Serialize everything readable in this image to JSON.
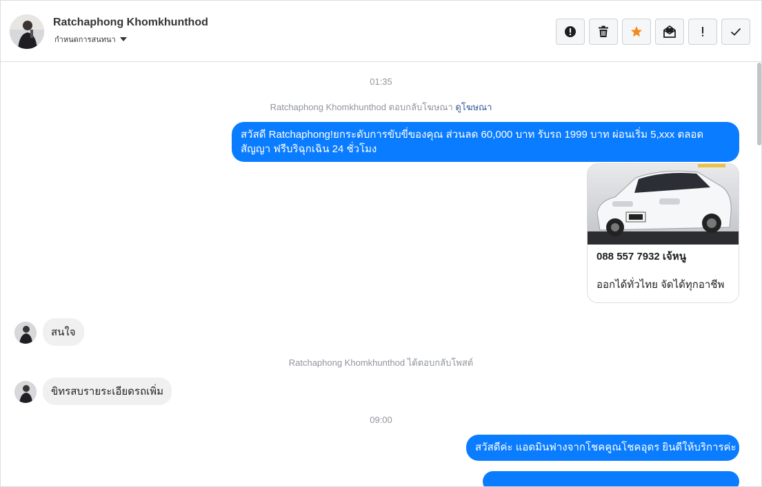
{
  "header": {
    "contact_name": "Ratchaphong Khomkhunthod",
    "assign_label": "กำหนดการสนทนา",
    "actions": [
      {
        "name": "spam-button",
        "icon": "alert-circle-icon"
      },
      {
        "name": "delete-button",
        "icon": "trash-icon"
      },
      {
        "name": "star-button",
        "icon": "star-icon"
      },
      {
        "name": "mark-unread-button",
        "icon": "envelope-icon"
      },
      {
        "name": "important-button",
        "icon": "exclamation-icon"
      },
      {
        "name": "done-button",
        "icon": "check-icon"
      }
    ]
  },
  "thread": {
    "timestamp_1": "01:35",
    "ad_reply_note": {
      "text": "Ratchaphong Khomkhunthod ตอบกลับโฆษณา",
      "link": "ดูโฆษณา"
    },
    "outgoing_1": {
      "line1": "สวัสดี Ratchaphong!ยกระดับการขับขี่ของคุณ ส่วนลด 60,000 บาท รับรถ 1999 บาท  ผ่อนเริ่ม 5,xxx ตลอด",
      "line2": "สัญญา ฟรีบริฉุกเฉิน 24 ชั่วโมง"
    },
    "ad_card": {
      "title": "088 557 7932 เจ้หนู",
      "description": "ออกได้ทั่วไทย จัดได้ทุกอาชีพ"
    },
    "incoming_1": "สนใจ",
    "post_reply_note": "Ratchaphong Khomkhunthod ได้ตอบกลับโพสต์",
    "incoming_2": "ขิทรสบรายระเอียดรถเพิ่ม",
    "timestamp_2": "09:00",
    "outgoing_2": "สวัสดีค่ะ แอดมินฟางจากโชคคูณโชคอุดร ยินดีให้บริการค่ะ"
  },
  "colors": {
    "outgoing_bubble": "#0a7cff",
    "incoming_bubble": "#f0f0f0",
    "star": "#f28a1e"
  }
}
